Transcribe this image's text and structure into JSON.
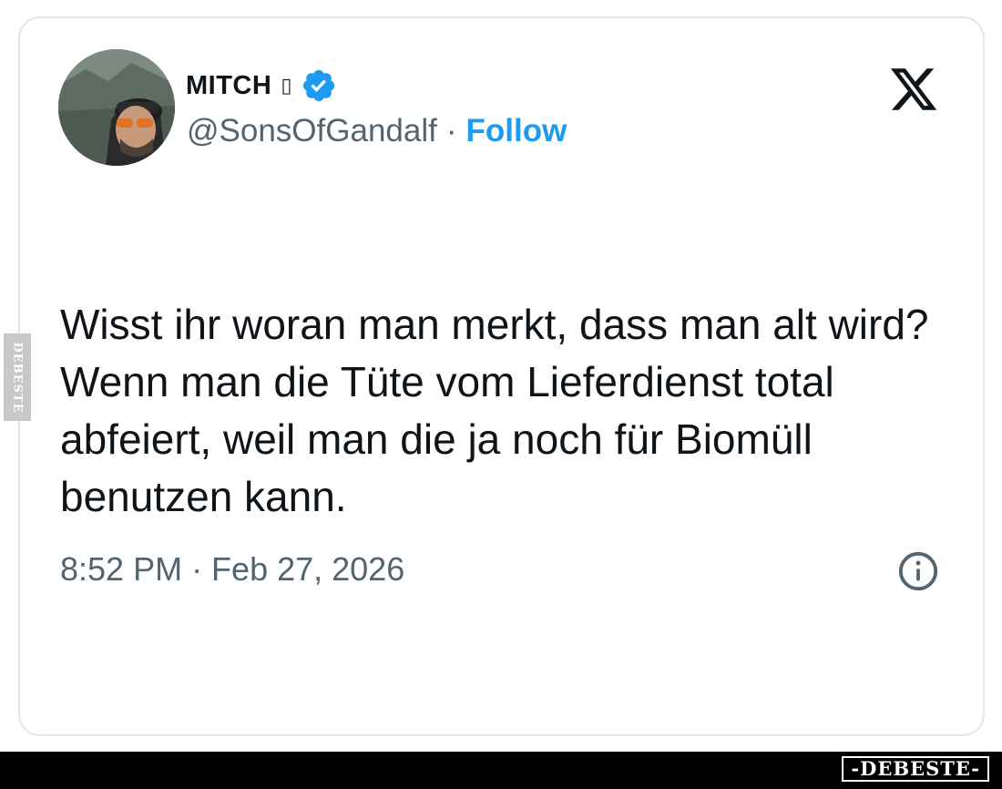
{
  "tweet": {
    "author": {
      "display_name": "MITCH",
      "name_emoji": "▯",
      "handle": "@SonsOfGandalf",
      "separator": "·",
      "follow_label": "Follow",
      "verified": true
    },
    "text": "Wisst ihr woran man merkt, dass man alt wird? Wenn man die Tüte vom Lieferdienst total abfeiert, weil man die ja noch für Biomüll benutzen kann.",
    "timestamp": "8:52 PM · Feb 27, 2026"
  },
  "icons": {
    "platform_logo": "x-logo-icon",
    "verified_badge": "verified-badge-icon",
    "info": "info-icon"
  },
  "watermark": {
    "side_label": "DEBESTE",
    "footer_label": "-DEBESTE-"
  },
  "colors": {
    "link_blue": "#1d9bf0",
    "text_primary": "#0f1419",
    "text_secondary": "#536471",
    "card_border": "#e4e6e8"
  }
}
